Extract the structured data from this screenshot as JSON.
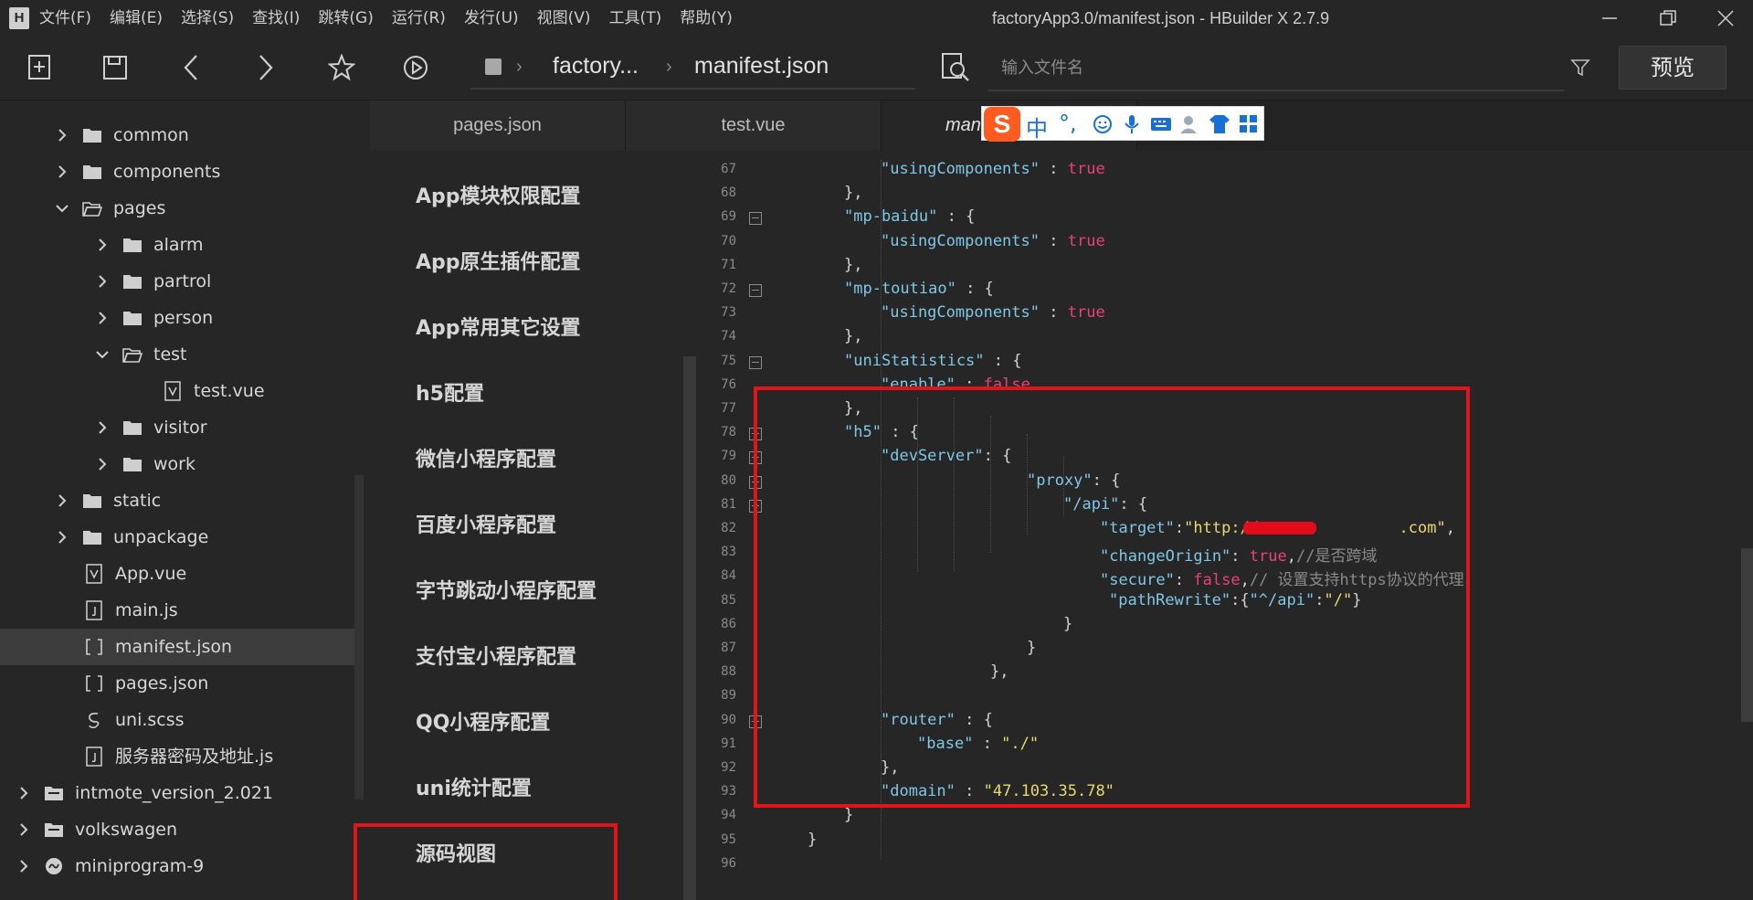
{
  "app": {
    "icon_letter": "H",
    "window_title": "factoryApp3.0/manifest.json - HBuilder X 2.7.9"
  },
  "menu": [
    "文件(F)",
    "编辑(E)",
    "选择(S)",
    "查找(I)",
    "跳转(G)",
    "运行(R)",
    "发行(U)",
    "视图(V)",
    "工具(T)",
    "帮助(Y)"
  ],
  "breadcrumb": {
    "project": "factory...",
    "file": "manifest.json"
  },
  "search": {
    "placeholder": "输入文件名"
  },
  "toolbar": {
    "preview_label": "预览"
  },
  "sidebar": {
    "items": [
      {
        "label": "common",
        "type": "folder",
        "expanded": false
      },
      {
        "label": "components",
        "type": "folder",
        "expanded": false
      },
      {
        "label": "pages",
        "type": "folder",
        "expanded": true
      },
      {
        "label": "alarm",
        "type": "folder",
        "expanded": false
      },
      {
        "label": "partrol",
        "type": "folder",
        "expanded": false
      },
      {
        "label": "person",
        "type": "folder",
        "expanded": false
      },
      {
        "label": "test",
        "type": "folder",
        "expanded": true
      },
      {
        "label": "test.vue",
        "type": "vue"
      },
      {
        "label": "visitor",
        "type": "folder",
        "expanded": false
      },
      {
        "label": "work",
        "type": "folder",
        "expanded": false
      },
      {
        "label": "static",
        "type": "folder",
        "expanded": false
      },
      {
        "label": "unpackage",
        "type": "folder",
        "expanded": false
      },
      {
        "label": "App.vue",
        "type": "vue"
      },
      {
        "label": "main.js",
        "type": "js"
      },
      {
        "label": "manifest.json",
        "type": "json",
        "selected": true
      },
      {
        "label": "pages.json",
        "type": "json"
      },
      {
        "label": "uni.scss",
        "type": "scss"
      },
      {
        "label": "服务器密码及地址.js",
        "type": "js"
      },
      {
        "label": "intmote_version_2.021",
        "type": "project",
        "expanded": false
      },
      {
        "label": "volkswagen",
        "type": "project",
        "expanded": false
      },
      {
        "label": "miniprogram-9",
        "type": "miniprogram",
        "expanded": false
      }
    ]
  },
  "tabs": [
    {
      "label": "pages.json",
      "active": false
    },
    {
      "label": "test.vue",
      "active": false
    },
    {
      "label": "mani",
      "active": true
    }
  ],
  "ime": {
    "logo": "S",
    "mode": "中",
    "punct": "°,"
  },
  "config_nav": [
    "App模块权限配置",
    "App原生插件配置",
    "App常用其它设置",
    "h5配置",
    "微信小程序配置",
    "百度小程序配置",
    "字节跳动小程序配置",
    "支付宝小程序配置",
    "QQ小程序配置",
    "uni统计配置",
    "源码视图"
  ],
  "code": {
    "line_numbers": [
      "67",
      "68",
      "69",
      "70",
      "71",
      "72",
      "73",
      "74",
      "75",
      "76",
      "77",
      "78",
      "79",
      "80",
      "81",
      "82",
      "83",
      "84",
      "85",
      "86",
      "87",
      "88",
      "89",
      "90",
      "91",
      "92",
      "93",
      "94",
      "95",
      "96"
    ],
    "lines": [
      "\"usingComponents\" : true",
      "},",
      "\"mp-baidu\" : {",
      "\"usingComponents\" : true",
      "},",
      "\"mp-toutiao\" : {",
      "\"usingComponents\" : true",
      "},",
      "\"uniStatistics\" : {",
      "\"enable\" : false",
      "},",
      "\"h5\" : {",
      "\"devServer\": {",
      "\"proxy\": {",
      "\"/api\": {",
      "\"target\":\"http://www.           .com\",",
      "\"changeOrigin\": true,//是否跨域",
      "\"secure\": false,// 设置支持https协议的代理",
      "\"pathRewrite\":{\"^/api\":\"/\"}",
      "}",
      "}",
      "},",
      "",
      "\"router\" : {",
      "\"base\" : \"./\"",
      "},",
      "\"domain\" : \"47.103.35.78\"",
      "}",
      "}",
      ""
    ]
  },
  "colors": {
    "highlight": "#e0141a",
    "keyword": "#7fc7e6",
    "boolean": "#e8427a",
    "string": "#e8d86f"
  }
}
